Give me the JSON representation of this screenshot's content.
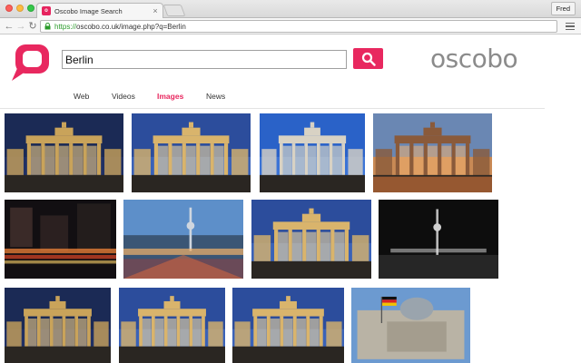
{
  "browser": {
    "tab_title": "Oscobo Image Search",
    "favicon_text": "o",
    "tab_close": "×",
    "profile_name": "Fred",
    "url_scheme": "https://",
    "url_rest": "oscobo.co.uk/image.php?q=Berlin"
  },
  "search": {
    "query": "Berlin",
    "brand_name": "oscobo"
  },
  "tabs": [
    {
      "label": "Web",
      "active": false
    },
    {
      "label": "Videos",
      "active": false
    },
    {
      "label": "Images",
      "active": true
    },
    {
      "label": "News",
      "active": false
    }
  ],
  "results": [
    {
      "scene": "gate-night"
    },
    {
      "scene": "gate-dusk"
    },
    {
      "scene": "gate-blue"
    },
    {
      "scene": "gate-sunset"
    },
    {
      "scene": "street-night"
    },
    {
      "scene": "skyline-dusk"
    },
    {
      "scene": "gate-dusk"
    },
    {
      "scene": "skyline-dark"
    },
    {
      "scene": "gate-night"
    },
    {
      "scene": "gate-dusk"
    },
    {
      "scene": "gate-dusk"
    },
    {
      "scene": "reichstag"
    }
  ],
  "colors": {
    "brand_pink": "#e8285f",
    "brand_grey": "#8b8b8b"
  }
}
